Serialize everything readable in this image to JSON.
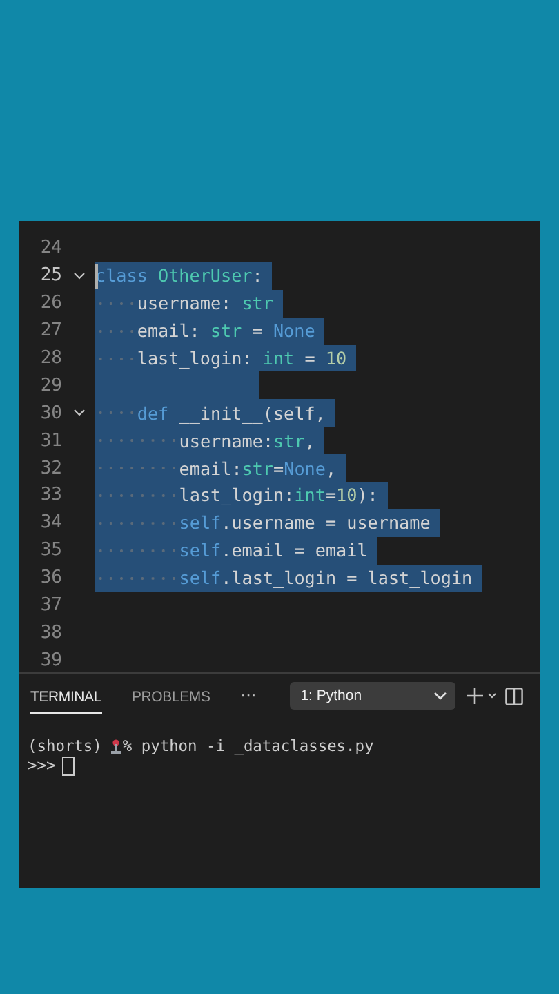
{
  "editor": {
    "lines": [
      {
        "number": "24",
        "selected": false,
        "foldable": false,
        "cursor": false
      },
      {
        "number": "25",
        "selected": true,
        "foldable": true,
        "cursor": true,
        "tokens": [
          {
            "kind": "keyword",
            "text": "class "
          },
          {
            "kind": "type",
            "text": "OtherUser"
          },
          {
            "kind": "plain",
            "text": ":"
          }
        ],
        "children": [
          {
            "number": "26",
            "selected": true,
            "foldable": false,
            "cursor": false,
            "tokens": [
              {
                "kind": "plain",
                "text": "username: "
              },
              {
                "kind": "type",
                "text": "str"
              }
            ]
          },
          {
            "number": "27",
            "selected": true,
            "foldable": false,
            "cursor": false,
            "tokens": [
              {
                "kind": "plain",
                "text": "email: "
              },
              {
                "kind": "type",
                "text": "str"
              },
              {
                "kind": "plain",
                "text": " = "
              },
              {
                "kind": "keyword",
                "text": "None"
              }
            ]
          },
          {
            "number": "28",
            "selected": true,
            "foldable": false,
            "cursor": false,
            "tokens": [
              {
                "kind": "plain",
                "text": "last_login: "
              },
              {
                "kind": "type",
                "text": "int"
              },
              {
                "kind": "plain",
                "text": " = "
              },
              {
                "kind": "number",
                "text": "10"
              }
            ]
          },
          {
            "number": "29",
            "selected": true,
            "foldable": false,
            "cursor": false
          },
          {
            "number": "30",
            "selected": true,
            "foldable": true,
            "cursor": false,
            "tokens": [
              {
                "kind": "keyword",
                "text": "def "
              },
              {
                "kind": "plain",
                "text": "__init__(self,"
              }
            ],
            "children": [
              {
                "number": "31",
                "selected": true,
                "foldable": false,
                "cursor": false,
                "tokens": [
                  {
                    "kind": "plain",
                    "text": "username:"
                  },
                  {
                    "kind": "type",
                    "text": "str"
                  },
                  {
                    "kind": "plain",
                    "text": ","
                  }
                ]
              },
              {
                "number": "32",
                "selected": true,
                "foldable": false,
                "cursor": false,
                "tokens": [
                  {
                    "kind": "plain",
                    "text": "email:"
                  },
                  {
                    "kind": "type",
                    "text": "str"
                  },
                  {
                    "kind": "plain",
                    "text": "="
                  },
                  {
                    "kind": "keyword",
                    "text": "None"
                  },
                  {
                    "kind": "plain",
                    "text": ","
                  }
                ]
              },
              {
                "number": "33",
                "selected": true,
                "foldable": false,
                "cursor": false,
                "tokens": [
                  {
                    "kind": "plain",
                    "text": "last_login:"
                  },
                  {
                    "kind": "type",
                    "text": "int"
                  },
                  {
                    "kind": "plain",
                    "text": "="
                  },
                  {
                    "kind": "number",
                    "text": "10"
                  },
                  {
                    "kind": "plain",
                    "text": "):"
                  }
                ]
              },
              {
                "number": "34",
                "selected": true,
                "foldable": false,
                "cursor": false,
                "tokens": [
                  {
                    "kind": "keyword",
                    "text": "self"
                  },
                  {
                    "kind": "plain",
                    "text": ".username = username"
                  }
                ]
              },
              {
                "number": "35",
                "selected": true,
                "foldable": false,
                "cursor": false,
                "tokens": [
                  {
                    "kind": "keyword",
                    "text": "self"
                  },
                  {
                    "kind": "plain",
                    "text": ".email = email"
                  }
                ]
              },
              {
                "number": "36",
                "selected": true,
                "foldable": false,
                "cursor": false,
                "tokens": [
                  {
                    "kind": "keyword",
                    "text": "self"
                  },
                  {
                    "kind": "plain",
                    "text": ".last_login = last_login"
                  }
                ]
              }
            ]
          }
        ]
      },
      {
        "number": "37",
        "selected": false,
        "foldable": false,
        "cursor": false
      },
      {
        "number": "38",
        "selected": false,
        "foldable": false,
        "cursor": false
      },
      {
        "number": "39",
        "selected": false,
        "foldable": false,
        "cursor": false
      }
    ]
  },
  "panel": {
    "tabs": [
      {
        "label": "TERMINAL",
        "selected": true
      },
      {
        "label": "PROBLEMS",
        "selected": false
      }
    ],
    "more": "···",
    "dropdown": {
      "value": "1: Python"
    }
  },
  "terminal": {
    "env": "(shorts)",
    "command": "% python -i _dataclasses.py",
    "prompt": ">>>"
  }
}
